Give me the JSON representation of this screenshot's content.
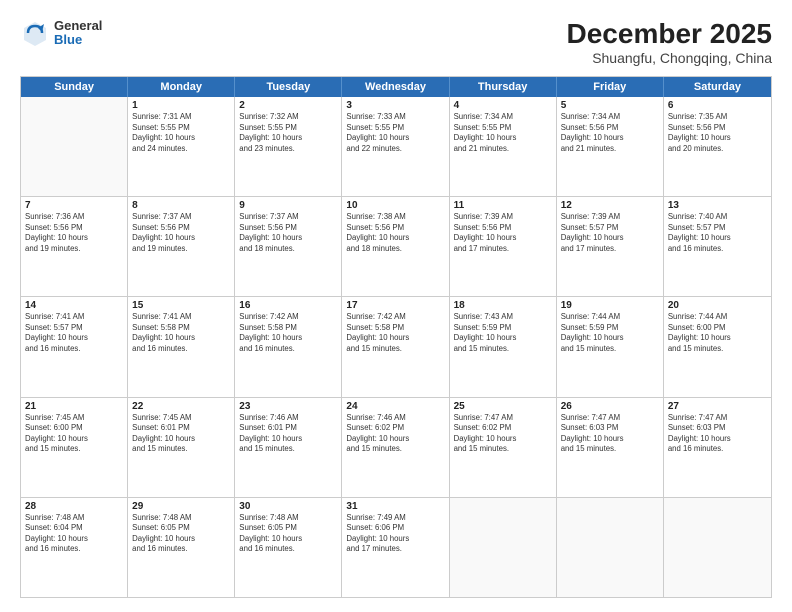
{
  "logo": {
    "line1": "General",
    "line2": "Blue"
  },
  "title": "December 2025",
  "subtitle": "Shuangfu, Chongqing, China",
  "header_days": [
    "Sunday",
    "Monday",
    "Tuesday",
    "Wednesday",
    "Thursday",
    "Friday",
    "Saturday"
  ],
  "weeks": [
    [
      {
        "day": "",
        "info": ""
      },
      {
        "day": "1",
        "info": "Sunrise: 7:31 AM\nSunset: 5:55 PM\nDaylight: 10 hours\nand 24 minutes."
      },
      {
        "day": "2",
        "info": "Sunrise: 7:32 AM\nSunset: 5:55 PM\nDaylight: 10 hours\nand 23 minutes."
      },
      {
        "day": "3",
        "info": "Sunrise: 7:33 AM\nSunset: 5:55 PM\nDaylight: 10 hours\nand 22 minutes."
      },
      {
        "day": "4",
        "info": "Sunrise: 7:34 AM\nSunset: 5:55 PM\nDaylight: 10 hours\nand 21 minutes."
      },
      {
        "day": "5",
        "info": "Sunrise: 7:34 AM\nSunset: 5:56 PM\nDaylight: 10 hours\nand 21 minutes."
      },
      {
        "day": "6",
        "info": "Sunrise: 7:35 AM\nSunset: 5:56 PM\nDaylight: 10 hours\nand 20 minutes."
      }
    ],
    [
      {
        "day": "7",
        "info": "Sunrise: 7:36 AM\nSunset: 5:56 PM\nDaylight: 10 hours\nand 19 minutes."
      },
      {
        "day": "8",
        "info": "Sunrise: 7:37 AM\nSunset: 5:56 PM\nDaylight: 10 hours\nand 19 minutes."
      },
      {
        "day": "9",
        "info": "Sunrise: 7:37 AM\nSunset: 5:56 PM\nDaylight: 10 hours\nand 18 minutes."
      },
      {
        "day": "10",
        "info": "Sunrise: 7:38 AM\nSunset: 5:56 PM\nDaylight: 10 hours\nand 18 minutes."
      },
      {
        "day": "11",
        "info": "Sunrise: 7:39 AM\nSunset: 5:56 PM\nDaylight: 10 hours\nand 17 minutes."
      },
      {
        "day": "12",
        "info": "Sunrise: 7:39 AM\nSunset: 5:57 PM\nDaylight: 10 hours\nand 17 minutes."
      },
      {
        "day": "13",
        "info": "Sunrise: 7:40 AM\nSunset: 5:57 PM\nDaylight: 10 hours\nand 16 minutes."
      }
    ],
    [
      {
        "day": "14",
        "info": "Sunrise: 7:41 AM\nSunset: 5:57 PM\nDaylight: 10 hours\nand 16 minutes."
      },
      {
        "day": "15",
        "info": "Sunrise: 7:41 AM\nSunset: 5:58 PM\nDaylight: 10 hours\nand 16 minutes."
      },
      {
        "day": "16",
        "info": "Sunrise: 7:42 AM\nSunset: 5:58 PM\nDaylight: 10 hours\nand 16 minutes."
      },
      {
        "day": "17",
        "info": "Sunrise: 7:42 AM\nSunset: 5:58 PM\nDaylight: 10 hours\nand 15 minutes."
      },
      {
        "day": "18",
        "info": "Sunrise: 7:43 AM\nSunset: 5:59 PM\nDaylight: 10 hours\nand 15 minutes."
      },
      {
        "day": "19",
        "info": "Sunrise: 7:44 AM\nSunset: 5:59 PM\nDaylight: 10 hours\nand 15 minutes."
      },
      {
        "day": "20",
        "info": "Sunrise: 7:44 AM\nSunset: 6:00 PM\nDaylight: 10 hours\nand 15 minutes."
      }
    ],
    [
      {
        "day": "21",
        "info": "Sunrise: 7:45 AM\nSunset: 6:00 PM\nDaylight: 10 hours\nand 15 minutes."
      },
      {
        "day": "22",
        "info": "Sunrise: 7:45 AM\nSunset: 6:01 PM\nDaylight: 10 hours\nand 15 minutes."
      },
      {
        "day": "23",
        "info": "Sunrise: 7:46 AM\nSunset: 6:01 PM\nDaylight: 10 hours\nand 15 minutes."
      },
      {
        "day": "24",
        "info": "Sunrise: 7:46 AM\nSunset: 6:02 PM\nDaylight: 10 hours\nand 15 minutes."
      },
      {
        "day": "25",
        "info": "Sunrise: 7:47 AM\nSunset: 6:02 PM\nDaylight: 10 hours\nand 15 minutes."
      },
      {
        "day": "26",
        "info": "Sunrise: 7:47 AM\nSunset: 6:03 PM\nDaylight: 10 hours\nand 15 minutes."
      },
      {
        "day": "27",
        "info": "Sunrise: 7:47 AM\nSunset: 6:03 PM\nDaylight: 10 hours\nand 16 minutes."
      }
    ],
    [
      {
        "day": "28",
        "info": "Sunrise: 7:48 AM\nSunset: 6:04 PM\nDaylight: 10 hours\nand 16 minutes."
      },
      {
        "day": "29",
        "info": "Sunrise: 7:48 AM\nSunset: 6:05 PM\nDaylight: 10 hours\nand 16 minutes."
      },
      {
        "day": "30",
        "info": "Sunrise: 7:48 AM\nSunset: 6:05 PM\nDaylight: 10 hours\nand 16 minutes."
      },
      {
        "day": "31",
        "info": "Sunrise: 7:49 AM\nSunset: 6:06 PM\nDaylight: 10 hours\nand 17 minutes."
      },
      {
        "day": "",
        "info": ""
      },
      {
        "day": "",
        "info": ""
      },
      {
        "day": "",
        "info": ""
      }
    ]
  ]
}
